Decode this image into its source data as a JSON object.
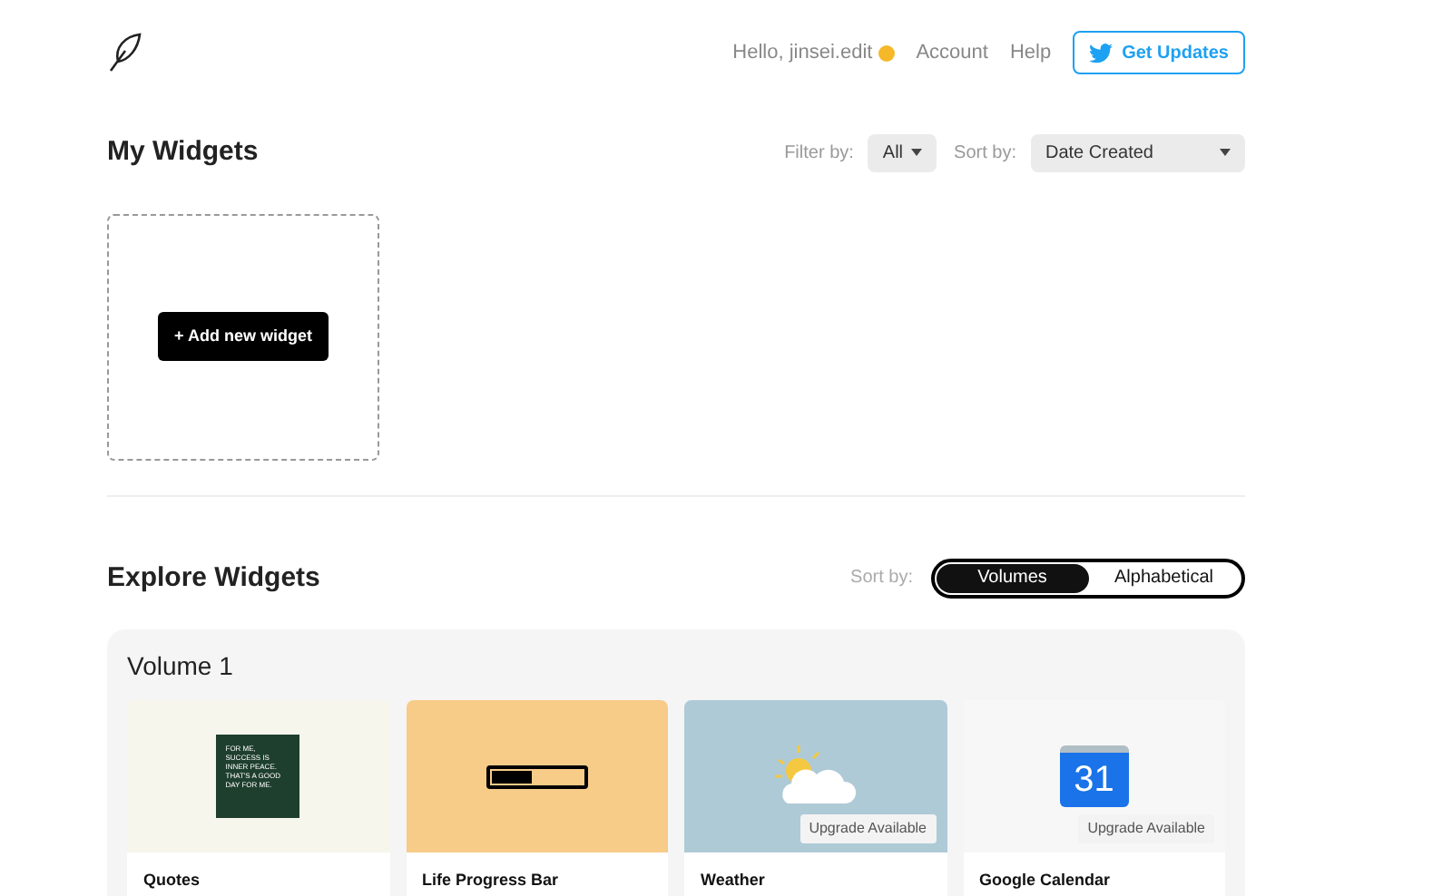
{
  "header": {
    "greeting": "Hello, jinsei.edit",
    "nav": [
      "Account",
      "Help"
    ],
    "updates_button": "Get Updates"
  },
  "my_widgets": {
    "title": "My Widgets",
    "filter_label": "Filter by:",
    "filter_value": "All",
    "sort_label": "Sort by:",
    "sort_value": "Date Created",
    "add_button": "+ Add new widget"
  },
  "explore": {
    "title": "Explore Widgets",
    "sort_label": "Sort by:",
    "sort_options": [
      {
        "label": "Volumes",
        "selected": true
      },
      {
        "label": "Alphabetical",
        "selected": false
      }
    ]
  },
  "volume": {
    "title": "Volume 1",
    "widgets": [
      {
        "kind": "quote",
        "name": "Quotes",
        "quote_text": "FOR ME, SUCCESS IS INNER PEACE. THAT'S A GOOD DAY FOR ME.",
        "color": "#f6f6ec"
      },
      {
        "kind": "progress",
        "name": "Life Progress Bar",
        "level": 0.45,
        "color": "#f7cb88"
      },
      {
        "kind": "weather",
        "name": "Weather",
        "badge": "Upgrade Available",
        "color": "#aecad6"
      },
      {
        "kind": "calendar",
        "name": "Google Calendar",
        "badge": "Upgrade Available",
        "calendar_day": "31",
        "color": "#f7f7f7"
      }
    ]
  }
}
